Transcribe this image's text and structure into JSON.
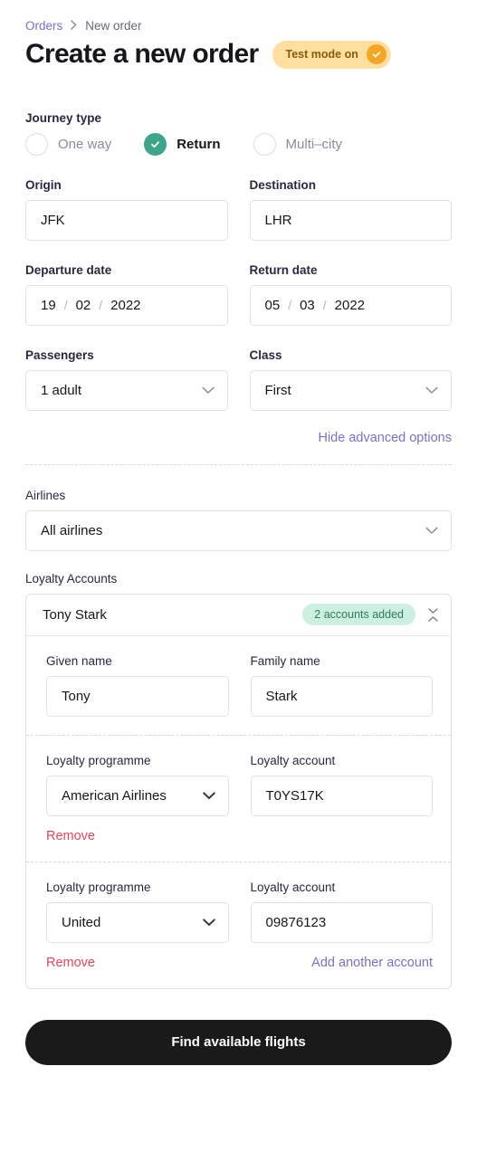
{
  "breadcrumb": {
    "parent": "Orders",
    "separator": "›",
    "current": "New order"
  },
  "header": {
    "title": "Create a new order",
    "test_badge": {
      "label": "Test mode on",
      "icon": "check-icon",
      "background": "#ffdfa0",
      "accent": "#f5a623"
    }
  },
  "journey_type": {
    "label": "Journey type",
    "options": [
      {
        "label": "One way",
        "selected": false
      },
      {
        "label": "Return",
        "selected": true
      },
      {
        "label": "Multi–city",
        "selected": false
      }
    ],
    "selected_color": "#3da68a"
  },
  "route": {
    "origin": {
      "label": "Origin",
      "value": "JFK",
      "placeholder": "Origin"
    },
    "destination": {
      "label": "Destination",
      "value": "LHR",
      "placeholder": "Destination"
    }
  },
  "dates": {
    "departure": {
      "label": "Departure date",
      "day": "19",
      "month": "02",
      "year": "2022",
      "separator": "/"
    },
    "return": {
      "label": "Return date",
      "day": "05",
      "month": "03",
      "year": "2022",
      "separator": "/"
    }
  },
  "passengers": {
    "label": "Passengers",
    "value": "1 adult"
  },
  "travel_class": {
    "label": "Class",
    "value": "First"
  },
  "advanced": {
    "toggle_label": "Hide advanced options"
  },
  "airlines": {
    "label": "Airlines",
    "value": "All airlines"
  },
  "loyalty": {
    "label": "Loyalty Accounts",
    "passenger_name": "Tony Stark",
    "count_badge": "2 accounts added",
    "badge_background": "#ccefe1",
    "badge_text_color": "#2f7a5c",
    "name_fields": {
      "given_name": {
        "label": "Given name",
        "value": "Tony"
      },
      "family_name": {
        "label": "Family name",
        "value": "Stark"
      }
    },
    "accounts": [
      {
        "programme_label": "Loyalty programme",
        "programme_value": "American Airlines",
        "account_label": "Loyalty account",
        "account_value": "T0YS17K",
        "remove_label": "Remove",
        "add_label": ""
      },
      {
        "programme_label": "Loyalty programme",
        "programme_value": "United",
        "account_label": "Loyalty account",
        "account_value": "09876123",
        "remove_label": "Remove",
        "add_label": "Add another account"
      }
    ]
  },
  "submit": {
    "label": "Find available flights",
    "background": "#1a1a1a"
  }
}
